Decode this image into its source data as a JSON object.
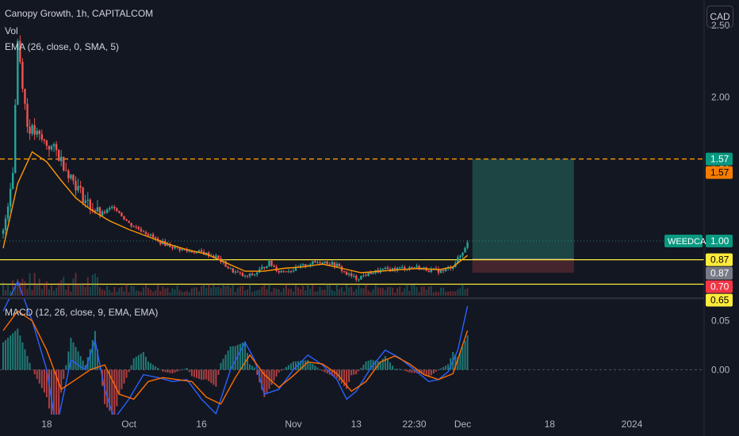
{
  "legend": {
    "title": "Canopy Growth, 1h, CAPITALCOM",
    "vol": "Vol",
    "ema": "EMA (26, close, 0, SMA, 5)",
    "macd": "MACD (12, 26, close, 9, EMA, EMA)"
  },
  "currency": "CAD",
  "colors": {
    "background": "#131722",
    "up": "#26a69a",
    "down": "#ef5350",
    "ema": "#ff9800",
    "macd_line": "#2962ff",
    "signal_line": "#ff6d00",
    "levels": "#ffeb3b",
    "target_zone": "#1f4e4a",
    "stop_zone": "#4a2730"
  },
  "chart_data": [
    {
      "type": "candlestick",
      "y_ticks": [
        "2.50",
        "2.00",
        "1.50",
        "1.00"
      ],
      "ylim": [
        0.62,
        2.62
      ],
      "x_ticks": [
        "18",
        "Oct",
        "16",
        "Nov",
        "13",
        "22:30",
        "Dec",
        "18",
        "2024"
      ],
      "close_path": [
        [
          0,
          1.05
        ],
        [
          2,
          1.5
        ],
        [
          3,
          2.4
        ],
        [
          5,
          1.8
        ],
        [
          8,
          1.7
        ],
        [
          11,
          1.62
        ],
        [
          14,
          1.45
        ],
        [
          17,
          1.28
        ],
        [
          20,
          1.18
        ],
        [
          23,
          1.24
        ],
        [
          26,
          1.12
        ],
        [
          29,
          1.07
        ],
        [
          32,
          1.0
        ],
        [
          35,
          0.96
        ],
        [
          38,
          0.93
        ],
        [
          41,
          0.92
        ],
        [
          44,
          0.89
        ],
        [
          47,
          0.8
        ],
        [
          50,
          0.75
        ],
        [
          52,
          0.77
        ],
        [
          55,
          0.85
        ],
        [
          57,
          0.79
        ],
        [
          60,
          0.8
        ],
        [
          63,
          0.84
        ],
        [
          66,
          0.86
        ],
        [
          69,
          0.83
        ],
        [
          71,
          0.77
        ],
        [
          73,
          0.74
        ],
        [
          76,
          0.78
        ],
        [
          79,
          0.8
        ],
        [
          82,
          0.81
        ],
        [
          85,
          0.82
        ],
        [
          88,
          0.8
        ],
        [
          91,
          0.79
        ],
        [
          93,
          0.83
        ],
        [
          95,
          0.92
        ],
        [
          96,
          1.0
        ]
      ],
      "ema_path": [
        [
          0,
          0.95
        ],
        [
          3,
          1.4
        ],
        [
          6,
          1.62
        ],
        [
          9,
          1.55
        ],
        [
          12,
          1.42
        ],
        [
          15,
          1.3
        ],
        [
          18,
          1.22
        ],
        [
          22,
          1.14
        ],
        [
          26,
          1.08
        ],
        [
          30,
          1.03
        ],
        [
          34,
          0.98
        ],
        [
          38,
          0.94
        ],
        [
          42,
          0.91
        ],
        [
          46,
          0.85
        ],
        [
          50,
          0.79
        ],
        [
          54,
          0.79
        ],
        [
          58,
          0.81
        ],
        [
          62,
          0.82
        ],
        [
          66,
          0.84
        ],
        [
          70,
          0.81
        ],
        [
          74,
          0.78
        ],
        [
          78,
          0.79
        ],
        [
          82,
          0.8
        ],
        [
          86,
          0.81
        ],
        [
          90,
          0.8
        ],
        [
          93,
          0.82
        ],
        [
          96,
          0.9
        ]
      ],
      "levels": [
        {
          "value": 1.57,
          "label": "1.57",
          "style": "dashed",
          "color": "#ff9800"
        },
        {
          "value": 0.87,
          "label": "0.87",
          "style": "solid",
          "color": "#ffeb3b"
        },
        {
          "value": 0.7,
          "label": "0.70",
          "style": "solid",
          "color": "#ffeb3b"
        }
      ],
      "position": {
        "x_start": 97,
        "x_end": 118,
        "entry": 0.875,
        "target": 1.57,
        "stop": 0.78
      },
      "price_labels": [
        {
          "value": 1.57,
          "text": "1.57",
          "bg": "#089981",
          "color": "#ffffff"
        },
        {
          "value": 1.57,
          "text": "1.57",
          "bg": "#f57c00",
          "color": "#000000"
        },
        {
          "value": 1.0,
          "text": "1.00",
          "bg": "#089981",
          "color": "#ffffff"
        },
        {
          "value": 0.87,
          "text": "0.87",
          "bg": "#ffeb3b",
          "color": "#000000"
        },
        {
          "value": 0.87,
          "text": "0.87",
          "bg": "#787b86",
          "color": "#ffffff"
        },
        {
          "value": 0.7,
          "text": "0.70",
          "bg": "#f23645",
          "color": "#ffffff"
        },
        {
          "value": 0.65,
          "text": "0.65",
          "bg": "#ffeb3b",
          "color": "#000000"
        }
      ],
      "symbol_tag": {
        "text": "WEEDCA",
        "value": 1.0
      }
    },
    {
      "type": "line",
      "y_ticks": [
        "0.05",
        "0.00"
      ],
      "ylim": [
        -0.045,
        0.07
      ],
      "macd_path": [
        [
          0,
          0.06
        ],
        [
          3,
          0.09
        ],
        [
          6,
          0.05
        ],
        [
          9,
          0.0
        ],
        [
          11,
          -0.06
        ],
        [
          14,
          0.01
        ],
        [
          17,
          0.0
        ],
        [
          19,
          0.03
        ],
        [
          21,
          -0.02
        ],
        [
          23,
          -0.05
        ],
        [
          26,
          -0.03
        ],
        [
          29,
          -0.005
        ],
        [
          32,
          -0.008
        ],
        [
          35,
          -0.012
        ],
        [
          38,
          -0.01
        ],
        [
          41,
          -0.03
        ],
        [
          44,
          -0.045
        ],
        [
          47,
          0.0
        ],
        [
          50,
          0.028
        ],
        [
          52,
          0.01
        ],
        [
          54,
          -0.025
        ],
        [
          57,
          -0.02
        ],
        [
          60,
          0.0
        ],
        [
          63,
          0.015
        ],
        [
          66,
          0.005
        ],
        [
          69,
          -0.01
        ],
        [
          71,
          -0.03
        ],
        [
          73,
          -0.022
        ],
        [
          76,
          0.002
        ],
        [
          79,
          0.02
        ],
        [
          82,
          0.012
        ],
        [
          85,
          0.0
        ],
        [
          88,
          -0.012
        ],
        [
          90,
          -0.01
        ],
        [
          92,
          -0.002
        ],
        [
          94,
          0.02
        ],
        [
          96,
          0.065
        ]
      ],
      "signal_path": [
        [
          0,
          0.04
        ],
        [
          3,
          0.06
        ],
        [
          6,
          0.05
        ],
        [
          9,
          0.02
        ],
        [
          12,
          -0.02
        ],
        [
          15,
          -0.01
        ],
        [
          18,
          0.0
        ],
        [
          21,
          0.005
        ],
        [
          24,
          -0.025
        ],
        [
          27,
          -0.03
        ],
        [
          30,
          -0.012
        ],
        [
          33,
          -0.008
        ],
        [
          36,
          -0.01
        ],
        [
          39,
          -0.012
        ],
        [
          42,
          -0.028
        ],
        [
          45,
          -0.035
        ],
        [
          48,
          -0.008
        ],
        [
          51,
          0.015
        ],
        [
          54,
          -0.005
        ],
        [
          57,
          -0.018
        ],
        [
          60,
          -0.006
        ],
        [
          63,
          0.008
        ],
        [
          66,
          0.006
        ],
        [
          69,
          -0.004
        ],
        [
          72,
          -0.022
        ],
        [
          75,
          -0.012
        ],
        [
          78,
          0.008
        ],
        [
          81,
          0.014
        ],
        [
          84,
          0.006
        ],
        [
          87,
          -0.005
        ],
        [
          90,
          -0.01
        ],
        [
          93,
          -0.004
        ],
        [
          96,
          0.04
        ]
      ]
    }
  ]
}
